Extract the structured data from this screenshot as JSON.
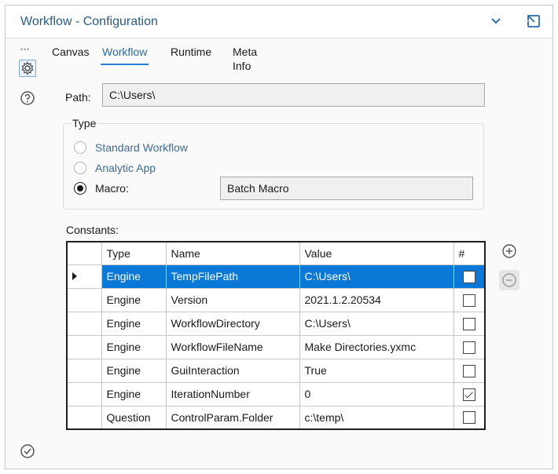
{
  "window": {
    "title": "Workflow - Configuration"
  },
  "tabs": [
    {
      "label": "Canvas",
      "active": false
    },
    {
      "label": "Workflow",
      "active": true
    },
    {
      "label": "Runtime",
      "active": false
    },
    {
      "label": "Meta Info",
      "active": false
    }
  ],
  "path": {
    "label": "Path:",
    "value": "C:\\Users\\"
  },
  "type_group": {
    "title": "Type",
    "options": [
      {
        "label": "Standard Workflow",
        "selected": false
      },
      {
        "label": "Analytic App",
        "selected": false
      },
      {
        "label": "Macro:",
        "selected": true
      }
    ],
    "macro_value": "Batch Macro"
  },
  "constants": {
    "label": "Constants:",
    "columns": [
      "Type",
      "Name",
      "Value",
      "#"
    ],
    "rows": [
      {
        "type": "Engine",
        "name": "TempFilePath",
        "value": "C:\\Users\\",
        "checked": false,
        "selected": true
      },
      {
        "type": "Engine",
        "name": "Version",
        "value": "2021.1.2.20534",
        "checked": false,
        "selected": false
      },
      {
        "type": "Engine",
        "name": "WorkflowDirectory",
        "value": "C:\\Users\\",
        "checked": false,
        "selected": false
      },
      {
        "type": "Engine",
        "name": "WorkflowFileName",
        "value": "Make Directories.yxmc",
        "checked": false,
        "selected": false
      },
      {
        "type": "Engine",
        "name": "GuiInteraction",
        "value": "True",
        "checked": false,
        "selected": false
      },
      {
        "type": "Engine",
        "name": "IterationNumber",
        "value": "0",
        "checked": true,
        "selected": false
      },
      {
        "type": "Question",
        "name": "ControlParam.Folder",
        "value": "c:\\temp\\",
        "checked": false,
        "selected": false
      }
    ]
  },
  "colors": {
    "accent": "#2b7fd0",
    "selection": "#0a78d7",
    "title": "#2b5b8a"
  }
}
